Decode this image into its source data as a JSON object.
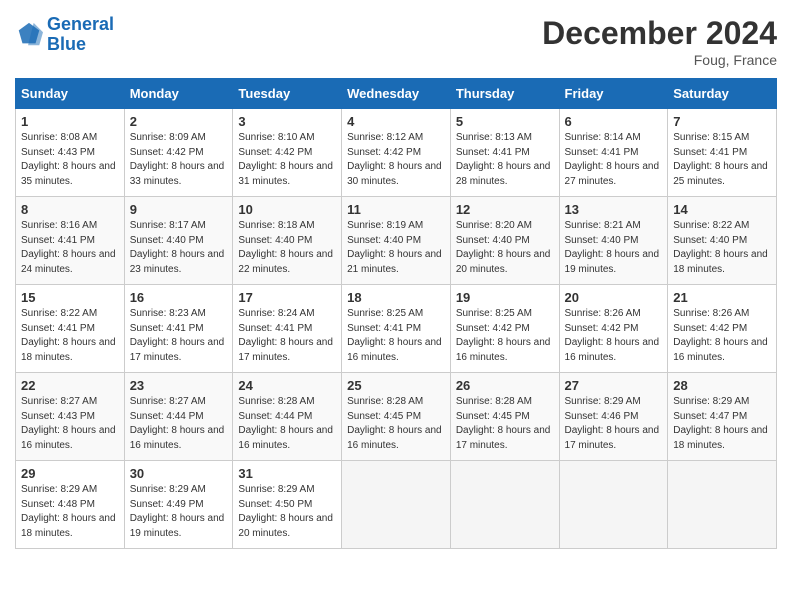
{
  "header": {
    "logo_line1": "General",
    "logo_line2": "Blue",
    "month": "December 2024",
    "location": "Foug, France"
  },
  "days_of_week": [
    "Sunday",
    "Monday",
    "Tuesday",
    "Wednesday",
    "Thursday",
    "Friday",
    "Saturday"
  ],
  "weeks": [
    [
      {
        "day": "1",
        "sunrise": "8:08 AM",
        "sunset": "4:43 PM",
        "daylight": "8 hours and 35 minutes."
      },
      {
        "day": "2",
        "sunrise": "8:09 AM",
        "sunset": "4:42 PM",
        "daylight": "8 hours and 33 minutes."
      },
      {
        "day": "3",
        "sunrise": "8:10 AM",
        "sunset": "4:42 PM",
        "daylight": "8 hours and 31 minutes."
      },
      {
        "day": "4",
        "sunrise": "8:12 AM",
        "sunset": "4:42 PM",
        "daylight": "8 hours and 30 minutes."
      },
      {
        "day": "5",
        "sunrise": "8:13 AM",
        "sunset": "4:41 PM",
        "daylight": "8 hours and 28 minutes."
      },
      {
        "day": "6",
        "sunrise": "8:14 AM",
        "sunset": "4:41 PM",
        "daylight": "8 hours and 27 minutes."
      },
      {
        "day": "7",
        "sunrise": "8:15 AM",
        "sunset": "4:41 PM",
        "daylight": "8 hours and 25 minutes."
      }
    ],
    [
      {
        "day": "8",
        "sunrise": "8:16 AM",
        "sunset": "4:41 PM",
        "daylight": "8 hours and 24 minutes."
      },
      {
        "day": "9",
        "sunrise": "8:17 AM",
        "sunset": "4:40 PM",
        "daylight": "8 hours and 23 minutes."
      },
      {
        "day": "10",
        "sunrise": "8:18 AM",
        "sunset": "4:40 PM",
        "daylight": "8 hours and 22 minutes."
      },
      {
        "day": "11",
        "sunrise": "8:19 AM",
        "sunset": "4:40 PM",
        "daylight": "8 hours and 21 minutes."
      },
      {
        "day": "12",
        "sunrise": "8:20 AM",
        "sunset": "4:40 PM",
        "daylight": "8 hours and 20 minutes."
      },
      {
        "day": "13",
        "sunrise": "8:21 AM",
        "sunset": "4:40 PM",
        "daylight": "8 hours and 19 minutes."
      },
      {
        "day": "14",
        "sunrise": "8:22 AM",
        "sunset": "4:40 PM",
        "daylight": "8 hours and 18 minutes."
      }
    ],
    [
      {
        "day": "15",
        "sunrise": "8:22 AM",
        "sunset": "4:41 PM",
        "daylight": "8 hours and 18 minutes."
      },
      {
        "day": "16",
        "sunrise": "8:23 AM",
        "sunset": "4:41 PM",
        "daylight": "8 hours and 17 minutes."
      },
      {
        "day": "17",
        "sunrise": "8:24 AM",
        "sunset": "4:41 PM",
        "daylight": "8 hours and 17 minutes."
      },
      {
        "day": "18",
        "sunrise": "8:25 AM",
        "sunset": "4:41 PM",
        "daylight": "8 hours and 16 minutes."
      },
      {
        "day": "19",
        "sunrise": "8:25 AM",
        "sunset": "4:42 PM",
        "daylight": "8 hours and 16 minutes."
      },
      {
        "day": "20",
        "sunrise": "8:26 AM",
        "sunset": "4:42 PM",
        "daylight": "8 hours and 16 minutes."
      },
      {
        "day": "21",
        "sunrise": "8:26 AM",
        "sunset": "4:42 PM",
        "daylight": "8 hours and 16 minutes."
      }
    ],
    [
      {
        "day": "22",
        "sunrise": "8:27 AM",
        "sunset": "4:43 PM",
        "daylight": "8 hours and 16 minutes."
      },
      {
        "day": "23",
        "sunrise": "8:27 AM",
        "sunset": "4:44 PM",
        "daylight": "8 hours and 16 minutes."
      },
      {
        "day": "24",
        "sunrise": "8:28 AM",
        "sunset": "4:44 PM",
        "daylight": "8 hours and 16 minutes."
      },
      {
        "day": "25",
        "sunrise": "8:28 AM",
        "sunset": "4:45 PM",
        "daylight": "8 hours and 16 minutes."
      },
      {
        "day": "26",
        "sunrise": "8:28 AM",
        "sunset": "4:45 PM",
        "daylight": "8 hours and 17 minutes."
      },
      {
        "day": "27",
        "sunrise": "8:29 AM",
        "sunset": "4:46 PM",
        "daylight": "8 hours and 17 minutes."
      },
      {
        "day": "28",
        "sunrise": "8:29 AM",
        "sunset": "4:47 PM",
        "daylight": "8 hours and 18 minutes."
      }
    ],
    [
      {
        "day": "29",
        "sunrise": "8:29 AM",
        "sunset": "4:48 PM",
        "daylight": "8 hours and 18 minutes."
      },
      {
        "day": "30",
        "sunrise": "8:29 AM",
        "sunset": "4:49 PM",
        "daylight": "8 hours and 19 minutes."
      },
      {
        "day": "31",
        "sunrise": "8:29 AM",
        "sunset": "4:50 PM",
        "daylight": "8 hours and 20 minutes."
      },
      null,
      null,
      null,
      null
    ]
  ]
}
